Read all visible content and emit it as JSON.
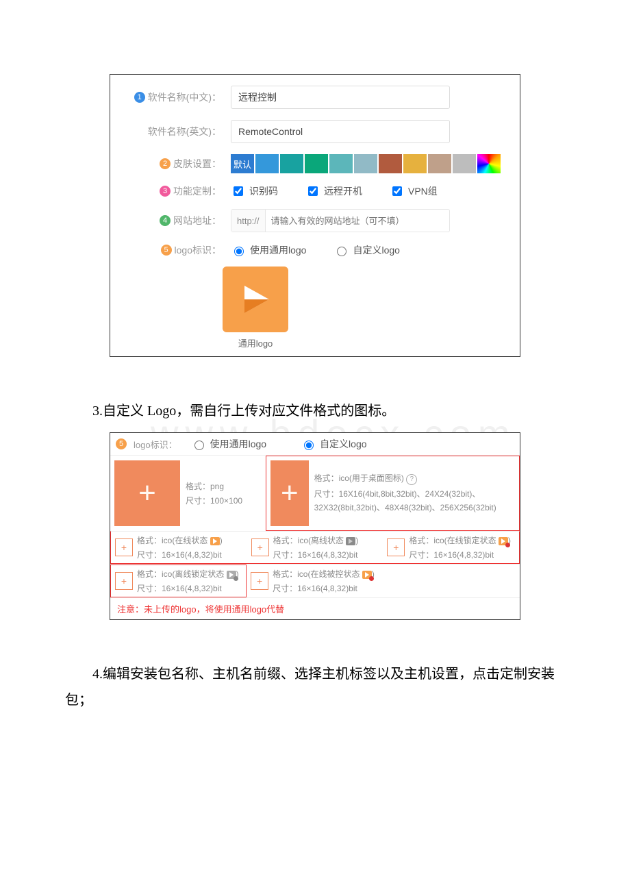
{
  "panel1": {
    "row1": {
      "badge_color": "#3a8ee6",
      "badge_num": "1",
      "label": "软件名称(中文)：",
      "value": "远程控制"
    },
    "row2": {
      "label": "软件名称(英文)：",
      "value": "RemoteControl"
    },
    "row3": {
      "badge_color": "#f7a04a",
      "badge_num": "2",
      "label": "皮肤设置：",
      "default_text": "默认",
      "colors": [
        "#2d7cd1",
        "#3498db",
        "#18a2a0",
        "#0aa77a",
        "#5cb6ba",
        "#91bac6",
        "#b15b3e",
        "#e6b13e",
        "#bfa08a",
        "#bdbdbd"
      ]
    },
    "row4": {
      "badge_color": "#f15a9c",
      "badge_num": "3",
      "label": "功能定制：",
      "opts": [
        "识别码",
        "远程开机",
        "VPN组"
      ]
    },
    "row5": {
      "badge_color": "#50b66a",
      "badge_num": "4",
      "label": "网站地址：",
      "prefix": "http://",
      "placeholder": "请输入有效的网站地址（可不填）"
    },
    "row6": {
      "badge_color": "#f7a04a",
      "badge_num": "5",
      "label": "logo标识：",
      "radio1": "使用通用logo",
      "radio2": "自定义logo",
      "caption": "通用logo"
    }
  },
  "text3": "3.自定义 Logo，需自行上传对应文件格式的图标。",
  "panel2": {
    "head": {
      "badge_color": "#f7a04a",
      "badge_num": "5",
      "label": "logo标识：",
      "radio1": "使用通用logo",
      "radio2": "自定义logo"
    },
    "big1": {
      "fmt": "格式：png",
      "size": "尺寸：100×100"
    },
    "big2": {
      "fmt": "格式：ico(用于桌面图标)",
      "sizes": "尺寸：16X16(4bit,8bit,32bit)、24X24(32bit)、32X32(8bit,32bit)、48X48(32bit)、256X256(32bit)"
    },
    "s1": {
      "fmt": "格式：ico(在线状态",
      "size": "尺寸：16×16(4,8,32)bit"
    },
    "s2": {
      "fmt": "格式：ico(离线状态",
      "size": "尺寸：16×16(4,8,32)bit"
    },
    "s3": {
      "fmt": "格式：ico(在线锁定状态",
      "size": "尺寸：16×16(4,8,32)bit"
    },
    "s4": {
      "fmt": "格式：ico(离线锁定状态",
      "size": "尺寸：16×16(4,8,32)bit"
    },
    "s5": {
      "fmt": "格式：ico(在线被控状态",
      "size": "尺寸：16×16(4,8,32)bit"
    },
    "note": "注意：未上传的logo，将使用通用logo代替"
  },
  "text4": "4.编辑安装包名称、主机名前缀、选择主机标签以及主机设置，点击定制安装包；",
  "watermark": "www.bdocx.com"
}
